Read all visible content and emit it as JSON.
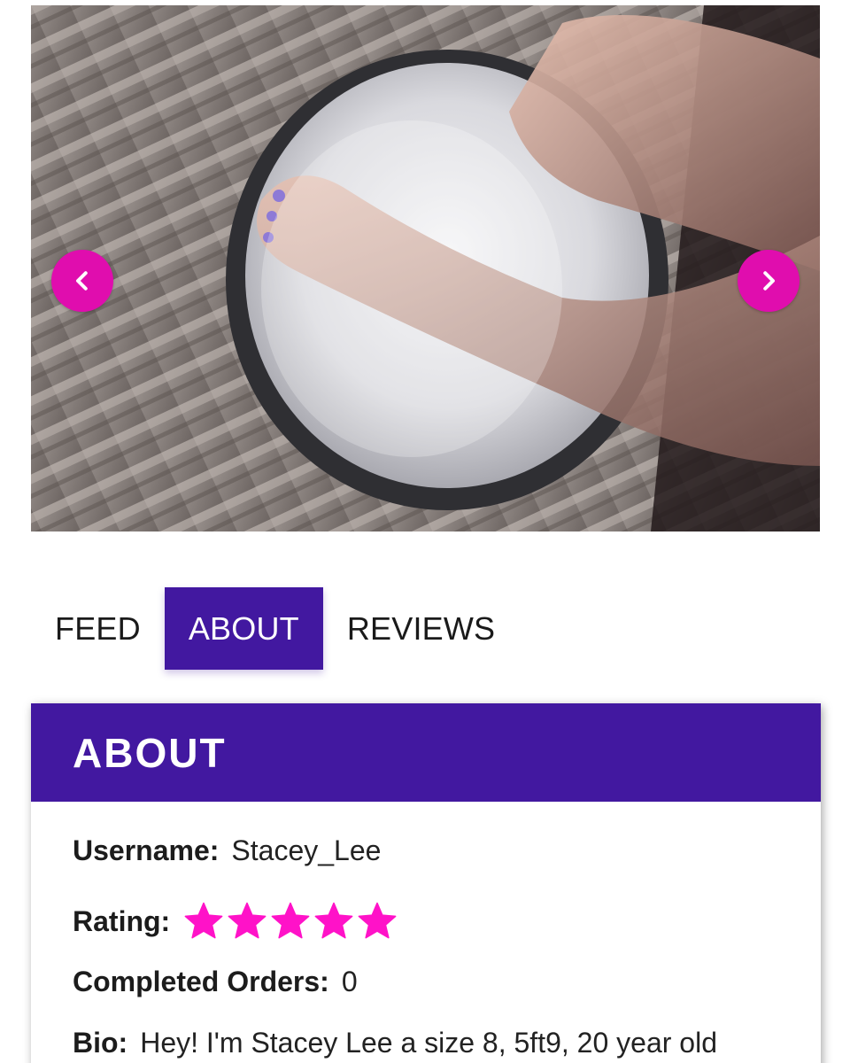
{
  "carousel": {
    "prev_icon": "chevron-left-icon",
    "next_icon": "chevron-right-icon",
    "accent_color": "#e00dae"
  },
  "tabs": [
    {
      "label": "FEED",
      "active": false
    },
    {
      "label": "ABOUT",
      "active": true
    },
    {
      "label": "REVIEWS",
      "active": false
    }
  ],
  "about": {
    "title": "ABOUT",
    "header_color": "#4218a0",
    "username_label": "Username:",
    "username_value": "Stacey_Lee",
    "rating_label": "Rating:",
    "rating_stars": 5,
    "rating_max": 5,
    "star_color": "#ff12c8",
    "orders_label": "Completed Orders:",
    "orders_value": "0",
    "bio_label": "Bio:",
    "bio_value": "Hey! I'm Stacey Lee a size 8, 5ft9, 20 year old"
  }
}
